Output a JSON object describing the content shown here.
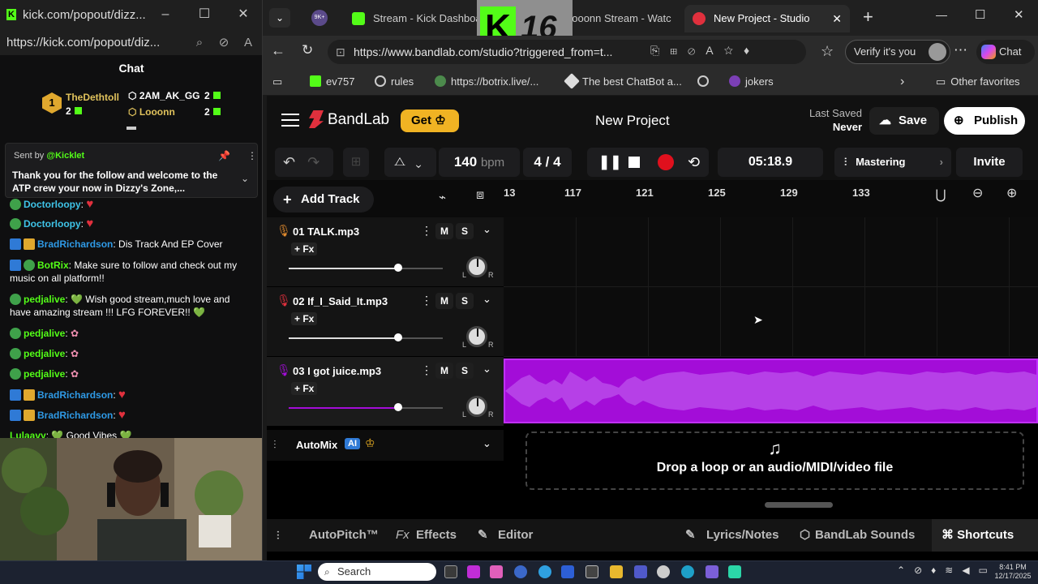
{
  "left_window": {
    "title": "kick.com/popout/dizz...",
    "url": "https://kick.com/popout/diz...",
    "chat_header": "Chat",
    "leaderboard": [
      {
        "rank": "1",
        "name": "TheDethtoll",
        "count": "2"
      },
      {
        "name": "2AM_AK_GG",
        "count": "2"
      },
      {
        "name": "Looonn",
        "count": "2"
      }
    ],
    "pinned": {
      "sent_by_label": "Sent by",
      "sender": "@Kicklet",
      "message": "Thank you for the follow and welcome to the ATP crew your now in Dizzy's Zone,..."
    },
    "messages": [
      {
        "user": "Doctorloopy",
        "text": ":",
        "color": "#3fc4e8"
      },
      {
        "user": "Doctorloopy",
        "text": ":",
        "color": "#3fc4e8"
      },
      {
        "user": "BradRichardson",
        "text": ": Dis Track And EP Cover",
        "color": "#2f9ae6"
      },
      {
        "user": "BotRix",
        "text": ": Make sure to follow and check out my music on all platform!!",
        "color": "#53fc18"
      },
      {
        "user": "pedjalive",
        "text": ": 💚 Wish good stream,much love and have amazing stream !!! LFG FOREVER!! 💚",
        "color": "#53fc18"
      },
      {
        "user": "pedjalive",
        "text": ":",
        "color": "#53fc18"
      },
      {
        "user": "pedjalive",
        "text": ":",
        "color": "#53fc18"
      },
      {
        "user": "pedjalive",
        "text": ":",
        "color": "#53fc18"
      },
      {
        "user": "BradRichardson",
        "text": ":",
        "color": "#2f9ae6"
      },
      {
        "user": "BradRichardson",
        "text": ":",
        "color": "#2f9ae6"
      },
      {
        "user": "Lulaavy",
        "text": ": 💚 Good Vibes 💚",
        "color": "#53fc18"
      }
    ]
  },
  "browser": {
    "tabs": [
      {
        "label": "Stream - Kick Dashboar",
        "active": false
      },
      {
        "label": "Looonn Stream - Watc",
        "active": false
      },
      {
        "label": "New Project - Studio",
        "active": true
      }
    ],
    "url": "https://www.bandlab.com/studio?triggered_from=t...",
    "verify_label": "Verify it's you",
    "chat_label": "Chat",
    "favorites": [
      "ev757",
      "rules",
      "https://botrix.live/...",
      "The best ChatBot a...",
      "",
      "jokers"
    ],
    "other_favorites": "Other favorites",
    "overlay_badge": "16",
    "tab_badge": "9K+"
  },
  "bandlab": {
    "brand": "BandLab",
    "get_label": "Get",
    "project_title": "New Project",
    "last_saved_label": "Last Saved",
    "last_saved_value": "Never",
    "save_label": "Save",
    "publish_label": "Publish",
    "tempo": "140",
    "tempo_unit": "bpm",
    "time_sig_num": "4",
    "time_sig_sep": "/",
    "time_sig_den": "4",
    "time": "05:18.9",
    "mastering_label": "Mastering",
    "invite_label": "Invite",
    "add_track_label": "Add Track",
    "ruler": [
      "13",
      "117",
      "121",
      "125",
      "129",
      "133"
    ],
    "tracks": [
      {
        "name": "01  TALK.mp3",
        "fx": "+ Fx",
        "mic_color": "#e08a2e",
        "volume": 0.71
      },
      {
        "name": "02  If_I_Said_It.mp3",
        "fx": "+ Fx",
        "mic_color": "#e0303d",
        "volume": 0.71
      },
      {
        "name": "03  I got juice.mp3",
        "fx": "+ Fx",
        "mic_color": "#a30dd8",
        "volume": 0.71
      }
    ],
    "mute_label": "M",
    "solo_label": "S",
    "pan_left": "L",
    "pan_right": "R",
    "automix_label": "AutoMix",
    "ai_badge": "AI",
    "drop_text": "Drop a loop or an audio/MIDI/video file",
    "bottom": {
      "autopitch": "AutoPitch™",
      "effects_prefix": "Fx",
      "effects": "Effects",
      "editor": "Editor",
      "lyrics": "Lyrics/Notes",
      "sounds": "BandLab Sounds",
      "shortcuts": "Shortcuts"
    },
    "waveform_color": "#a30dd8"
  },
  "taskbar": {
    "search": "Search",
    "time": "8:41 PM",
    "date": "12/17/2025"
  }
}
